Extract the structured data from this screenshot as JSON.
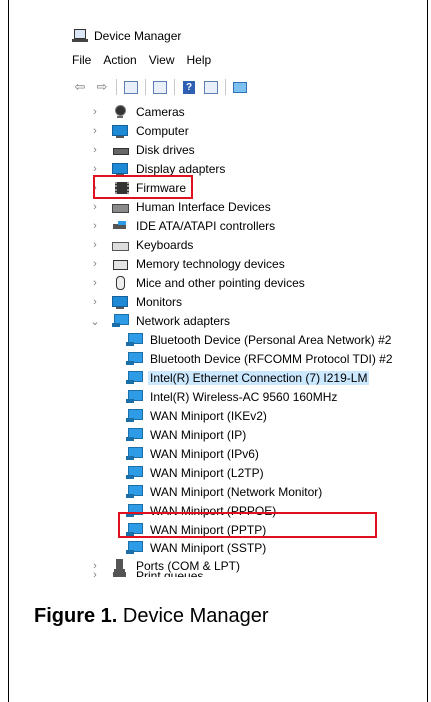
{
  "window": {
    "title": "Device Manager",
    "icon": "device-manager-icon"
  },
  "menu": [
    "File",
    "Action",
    "View",
    "Help"
  ],
  "toolbar": {
    "icons": [
      "back-arrow-icon",
      "forward-arrow-icon",
      "show-hide-console-tree-icon",
      "properties-icon",
      "help-icon",
      "action-pane-icon",
      "scan-hardware-changes-icon"
    ],
    "help_glyph": "?"
  },
  "tree": {
    "categories": [
      {
        "label": "Cameras",
        "icon": "camera-icon",
        "expanded": false
      },
      {
        "label": "Computer",
        "icon": "computer-icon",
        "expanded": false
      },
      {
        "label": "Disk drives",
        "icon": "disk-drive-icon",
        "expanded": false
      },
      {
        "label": "Display adapters",
        "icon": "display-adapter-icon",
        "expanded": false
      },
      {
        "label": "Firmware",
        "icon": "firmware-icon",
        "expanded": false
      },
      {
        "label": "Human Interface Devices",
        "icon": "hid-icon",
        "expanded": false
      },
      {
        "label": "IDE ATA/ATAPI controllers",
        "icon": "ide-controller-icon",
        "expanded": false
      },
      {
        "label": "Keyboards",
        "icon": "keyboard-icon",
        "expanded": false
      },
      {
        "label": "Memory technology devices",
        "icon": "memory-device-icon",
        "expanded": false
      },
      {
        "label": "Mice and other pointing devices",
        "icon": "mouse-icon",
        "expanded": false
      },
      {
        "label": "Monitors",
        "icon": "monitor-icon",
        "expanded": false
      },
      {
        "label": "Network adapters",
        "icon": "network-adapter-icon",
        "expanded": true
      },
      {
        "label": "Ports (COM & LPT)",
        "icon": "ports-icon",
        "expanded": false
      },
      {
        "label": "Print queues",
        "icon": "printer-icon",
        "expanded": false
      }
    ],
    "network_adapters": [
      "Bluetooth Device (Personal Area Network) #2",
      "Bluetooth Device (RFCOMM Protocol TDI) #2",
      "Intel(R) Ethernet Connection (7) I219-LM",
      "Intel(R) Wireless-AC 9560 160MHz",
      "WAN Miniport (IKEv2)",
      "WAN Miniport (IP)",
      "WAN Miniport (IPv6)",
      "WAN Miniport (L2TP)",
      "WAN Miniport (Network Monitor)",
      "WAN Miniport (PPPOE)",
      "WAN Miniport (PPTP)",
      "WAN Miniport (SSTP)"
    ],
    "selected": "Intel(R) Ethernet Connection (7) I219-LM",
    "highlighted": [
      "Firmware",
      "WAN Miniport (PPTP)"
    ],
    "highlight_color": "#e0101e",
    "selection_color": "#cce8ff"
  },
  "caption": {
    "label": "Figure 1.",
    "text": " Device Manager"
  }
}
